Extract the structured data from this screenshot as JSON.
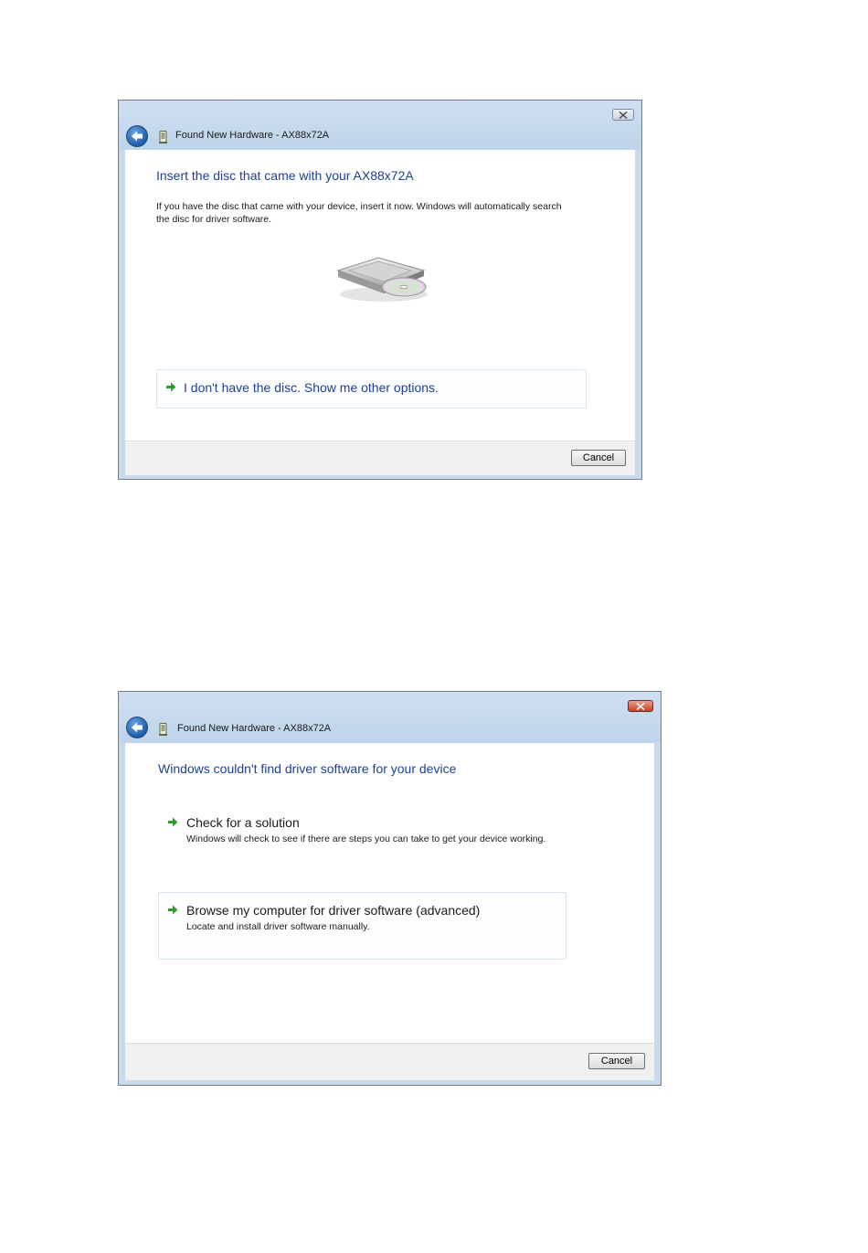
{
  "dialog1": {
    "window_title": "Found New Hardware - AX88x72A",
    "heading": "Insert the disc that came with your AX88x72A",
    "description": "If you have the disc that came with your device, insert it now.  Windows will automatically search the disc for driver software.",
    "option_label": "I don't have the disc.  Show me other options.",
    "cancel_label": "Cancel",
    "icons": [
      "back-arrow-icon",
      "hardware-device-icon",
      "disc-drive-icon",
      "green-arrow-icon",
      "close-icon"
    ]
  },
  "dialog2": {
    "window_title": "Found New Hardware - AX88x72A",
    "heading": "Windows couldn't find driver software for your device",
    "options": [
      {
        "title": "Check for a solution",
        "description": "Windows will check to see if there are steps you can take to get your device working."
      },
      {
        "title": "Browse my computer for driver software (advanced)",
        "description": "Locate and install driver software manually."
      }
    ],
    "cancel_label": "Cancel",
    "icons": [
      "back-arrow-icon",
      "hardware-device-icon",
      "green-arrow-icon",
      "close-icon"
    ]
  },
  "colors": {
    "heading_blue": "#1e3f96",
    "title_bar": "#c9daea",
    "arrow_green": "#2f9e2f",
    "close_red": "#c3412a"
  }
}
